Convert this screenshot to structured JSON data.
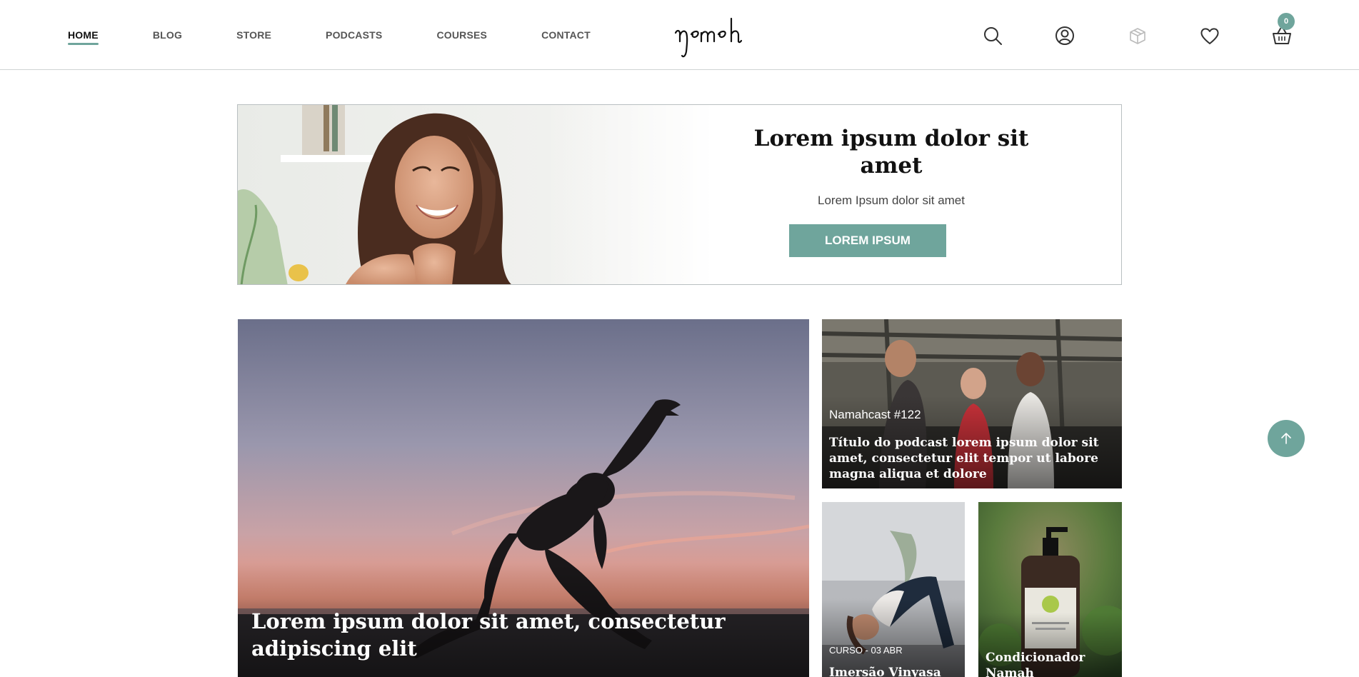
{
  "nav": {
    "items": [
      {
        "label": "HOME",
        "active": true
      },
      {
        "label": "BLOG",
        "active": false
      },
      {
        "label": "STORE",
        "active": false
      },
      {
        "label": "PODCASTS",
        "active": false
      },
      {
        "label": "COURSES",
        "active": false
      },
      {
        "label": "CONTACT",
        "active": false
      }
    ]
  },
  "logo": {
    "text": "namah"
  },
  "header_icons": {
    "search": "search-icon",
    "account": "user-circle-icon",
    "box": "box-icon",
    "wishlist": "heart-icon",
    "cart": "basket-icon",
    "cart_count": "0"
  },
  "banner": {
    "title": "Lorem ipsum dolor sit amet",
    "subtitle": "Lorem Ipsum dolor sit amet",
    "button_label": "LOREM IPSUM"
  },
  "cards": {
    "main": {
      "title": "Lorem ipsum dolor sit amet, consectetur adipiscing elit"
    },
    "podcast": {
      "tag": "Namahcast #122",
      "title": "Título do podcast lorem ipsum dolor sit amet, consectetur elit tempor ut labore magna aliqua et dolore"
    },
    "course": {
      "tag": "CURSO - 03 ABR",
      "title": "Imersão Vinyasa"
    },
    "product": {
      "title": "Condicionador Namah"
    }
  },
  "colors": {
    "accent": "#6fa59c",
    "text_dark": "#111111",
    "border": "#cfd3d4"
  },
  "scroll_top": {
    "icon": "arrow-up-icon"
  }
}
